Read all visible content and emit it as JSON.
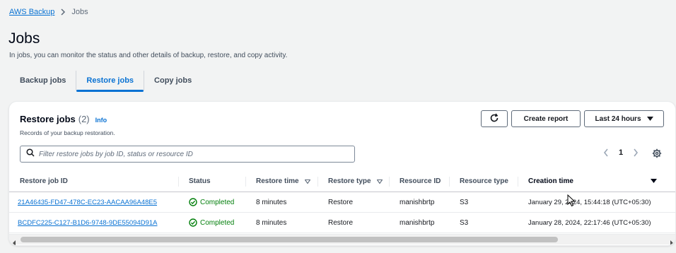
{
  "breadcrumb": {
    "root": "AWS Backup",
    "current": "Jobs"
  },
  "header": {
    "title": "Jobs",
    "description": "In jobs, you can monitor the status and other details of backup, restore, and copy activity."
  },
  "tabs": [
    {
      "label": "Backup jobs",
      "active": false
    },
    {
      "label": "Restore jobs",
      "active": true
    },
    {
      "label": "Copy jobs",
      "active": false
    }
  ],
  "panel": {
    "title": "Restore jobs",
    "count": "(2)",
    "info": "Info",
    "description": "Records of your backup restoration.",
    "create_report": "Create report",
    "time_range": "Last 24 hours",
    "search_placeholder": "Filter restore jobs by job ID, status or resource ID",
    "page": "1"
  },
  "table": {
    "columns": [
      "Restore job ID",
      "Status",
      "Restore time",
      "Restore type",
      "Resource ID",
      "Resource type",
      "Creation time"
    ],
    "rows": [
      [
        "21A46435-FD47-478C-EC23-AACAA96A48E5",
        "Completed",
        "8 minutes",
        "Restore",
        "manishbrtp",
        "S3",
        "January 29, 2024, 15:44:18 (UTC+05:30)"
      ],
      [
        "BCDFC225-C127-B1D6-9748-9DE55094D91A",
        "Completed",
        "8 minutes",
        "Restore",
        "manishbrtp",
        "S3",
        "January 28, 2024, 22:17:46 (UTC+05:30)"
      ]
    ]
  },
  "colors": {
    "link": "#0972d3",
    "success": "#037f0c",
    "background": "#f2f3f3"
  },
  "icons": [
    "chevron-right-icon",
    "refresh-icon",
    "caret-down-icon",
    "search-icon",
    "chevron-left-icon",
    "settings-icon",
    "sort-icon",
    "check-circle-icon"
  ]
}
